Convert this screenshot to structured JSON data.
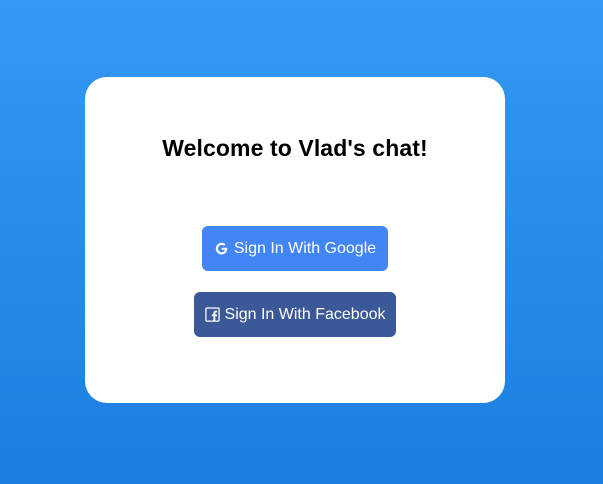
{
  "card": {
    "title": "Welcome to Vlad's chat!"
  },
  "buttons": {
    "google": {
      "label": "Sign In With Google",
      "icon": "google-icon",
      "color": "#4285f4"
    },
    "facebook": {
      "label": "Sign In With Facebook",
      "icon": "facebook-icon",
      "color": "#3b5998"
    }
  },
  "colors": {
    "background_top": "#3399f2",
    "background_bottom": "#1c7fe0",
    "card": "#ffffff"
  }
}
